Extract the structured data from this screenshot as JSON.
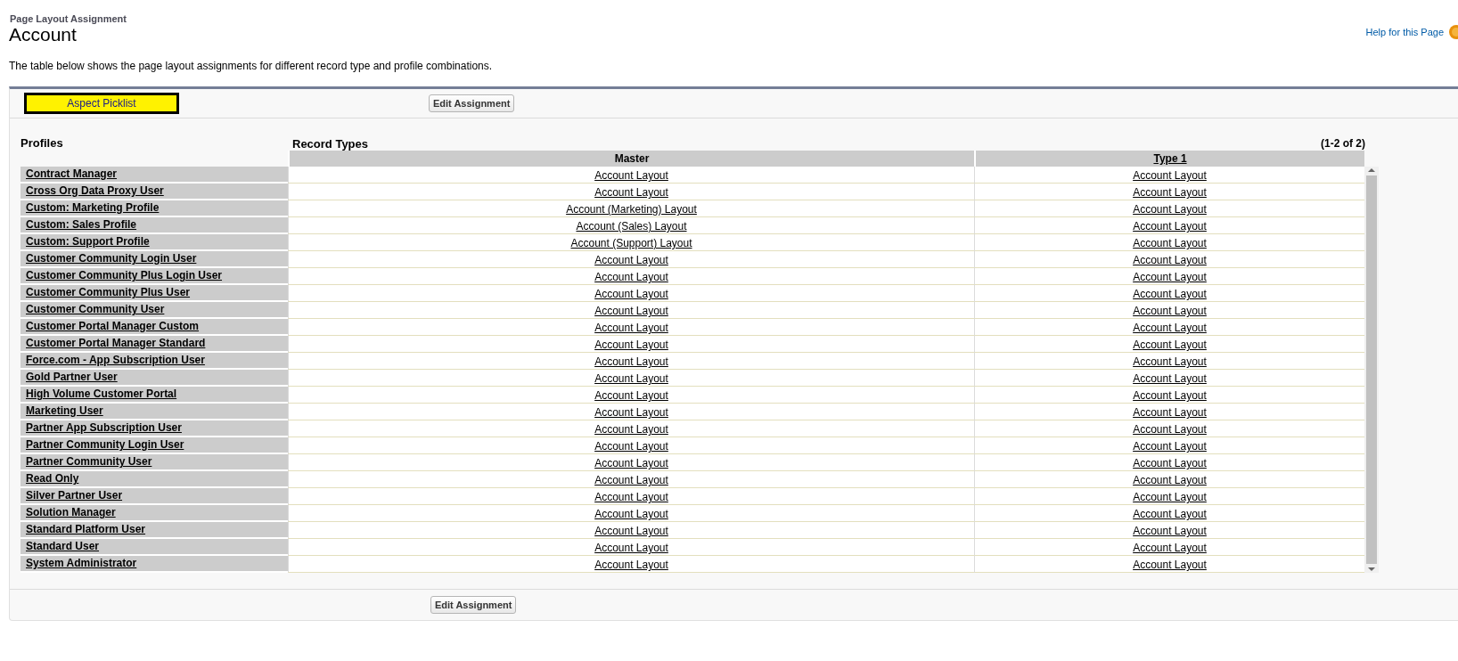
{
  "header": {
    "breadcrumb": "Page Layout Assignment",
    "title": "Account",
    "help_link": "Help for this Page"
  },
  "description": "The table below shows the page layout assignments for different record type and profile combinations.",
  "top_bar": {
    "highlight_label": "Aspect Picklist",
    "button": "Edit Assignment"
  },
  "table": {
    "profiles_heading": "Profiles",
    "record_types_heading": "Record Types",
    "count": "(1-2 of 2)",
    "columns": [
      {
        "label": "Master",
        "linked": false
      },
      {
        "label": "Type 1",
        "linked": true
      }
    ],
    "rows": [
      {
        "profile": "Contract Manager",
        "layouts": [
          "Account Layout",
          "Account Layout"
        ]
      },
      {
        "profile": "Cross Org Data Proxy User",
        "layouts": [
          "Account Layout",
          "Account Layout"
        ]
      },
      {
        "profile": "Custom: Marketing Profile",
        "layouts": [
          "Account (Marketing) Layout",
          "Account Layout"
        ]
      },
      {
        "profile": "Custom: Sales Profile",
        "layouts": [
          "Account (Sales) Layout",
          "Account Layout"
        ]
      },
      {
        "profile": "Custom: Support Profile",
        "layouts": [
          "Account (Support) Layout",
          "Account Layout"
        ]
      },
      {
        "profile": "Customer Community Login User",
        "layouts": [
          "Account Layout",
          "Account Layout"
        ]
      },
      {
        "profile": "Customer Community Plus Login User",
        "layouts": [
          "Account Layout",
          "Account Layout"
        ]
      },
      {
        "profile": "Customer Community Plus User",
        "layouts": [
          "Account Layout",
          "Account Layout"
        ]
      },
      {
        "profile": "Customer Community User",
        "layouts": [
          "Account Layout",
          "Account Layout"
        ]
      },
      {
        "profile": "Customer Portal Manager Custom",
        "layouts": [
          "Account Layout",
          "Account Layout"
        ]
      },
      {
        "profile": "Customer Portal Manager Standard",
        "layouts": [
          "Account Layout",
          "Account Layout"
        ]
      },
      {
        "profile": "Force.com - App Subscription User",
        "layouts": [
          "Account Layout",
          "Account Layout"
        ]
      },
      {
        "profile": "Gold Partner User",
        "layouts": [
          "Account Layout",
          "Account Layout"
        ]
      },
      {
        "profile": "High Volume Customer Portal",
        "layouts": [
          "Account Layout",
          "Account Layout"
        ]
      },
      {
        "profile": "Marketing User",
        "layouts": [
          "Account Layout",
          "Account Layout"
        ]
      },
      {
        "profile": "Partner App Subscription User",
        "layouts": [
          "Account Layout",
          "Account Layout"
        ]
      },
      {
        "profile": "Partner Community Login User",
        "layouts": [
          "Account Layout",
          "Account Layout"
        ]
      },
      {
        "profile": "Partner Community User",
        "layouts": [
          "Account Layout",
          "Account Layout"
        ]
      },
      {
        "profile": "Read Only",
        "layouts": [
          "Account Layout",
          "Account Layout"
        ]
      },
      {
        "profile": "Silver Partner User",
        "layouts": [
          "Account Layout",
          "Account Layout"
        ]
      },
      {
        "profile": "Solution Manager",
        "layouts": [
          "Account Layout",
          "Account Layout"
        ]
      },
      {
        "profile": "Standard Platform User",
        "layouts": [
          "Account Layout",
          "Account Layout"
        ]
      },
      {
        "profile": "Standard User",
        "layouts": [
          "Account Layout",
          "Account Layout"
        ]
      },
      {
        "profile": "System Administrator",
        "layouts": [
          "Account Layout",
          "Account Layout"
        ]
      }
    ]
  },
  "bottom_bar": {
    "button": "Edit Assignment"
  }
}
